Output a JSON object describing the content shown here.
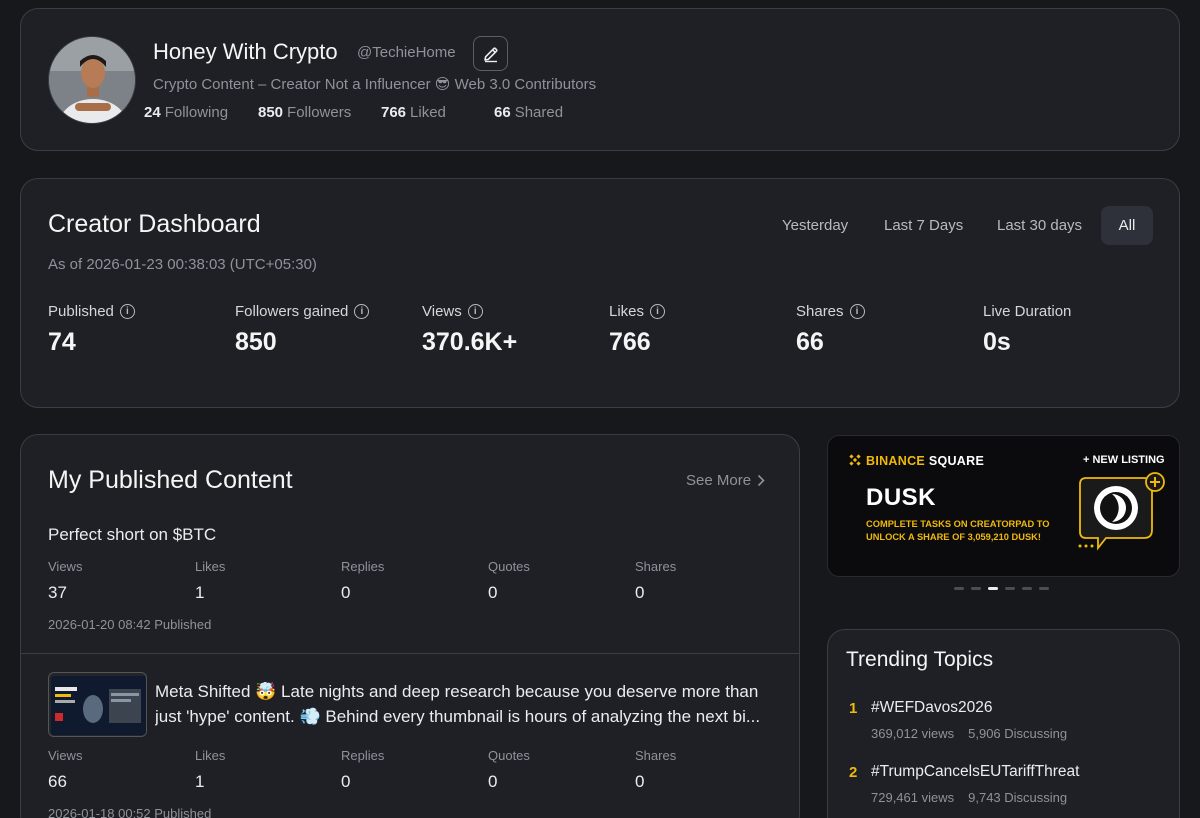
{
  "profile": {
    "display_name": "Honey With Crypto",
    "handle": "@TechieHome",
    "bio": "Crypto Content – Creator Not a Influencer 😎 Web 3.0 Contributors",
    "following_count": "24",
    "following_label": "Following",
    "followers_count": "850",
    "followers_label": "Followers",
    "liked_count": "766",
    "liked_label": "Liked",
    "shared_count": "66",
    "shared_label": "Shared"
  },
  "dashboard": {
    "title": "Creator Dashboard",
    "as_of": "As of 2026-01-23 00:38:03 (UTC+05:30)",
    "ranges": [
      "Yesterday",
      "Last 7 Days",
      "Last 30 days",
      "All"
    ],
    "active_range": "All",
    "metrics": [
      {
        "label": "Published",
        "value": "74",
        "info": true
      },
      {
        "label": "Followers gained",
        "value": "850",
        "info": true
      },
      {
        "label": "Views",
        "value": "370.6K+",
        "info": true
      },
      {
        "label": "Likes",
        "value": "766",
        "info": true
      },
      {
        "label": "Shares",
        "value": "66",
        "info": true
      },
      {
        "label": "Live Duration",
        "value": "0s",
        "info": false
      }
    ]
  },
  "published": {
    "title": "My Published Content",
    "see_more": "See More",
    "columns": [
      "Views",
      "Likes",
      "Replies",
      "Quotes",
      "Shares"
    ],
    "posts": [
      {
        "text": "Perfect short on $BTC",
        "values": [
          "37",
          "1",
          "0",
          "0",
          "0"
        ],
        "date": "2026-01-20 08:42 Published"
      },
      {
        "text_line1": "Meta Shifted 🤯 Late nights and deep research because you deserve more than",
        "text_line2": "just 'hype' content. 💨 Behind every thumbnail is hours of analyzing the next bi...",
        "values": [
          "66",
          "1",
          "0",
          "0",
          "0"
        ],
        "date": "2026-01-18 00:52 Published"
      }
    ]
  },
  "banner": {
    "brand_a": "BINANCE",
    "brand_b": " SQUARE",
    "new_listing": "+ NEW LISTING",
    "coin": "DUSK",
    "desc_line1": "COMPLETE TASKS ON CREATORPAD TO",
    "desc_line2": "UNLOCK A SHARE OF 3,059,210 DUSK!",
    "slide_count": 6,
    "active_slide": 3,
    "colors": {
      "accent": "#f0b90b",
      "background": "#0b0b0d"
    }
  },
  "trending": {
    "title": "Trending Topics",
    "items": [
      {
        "rank": "1",
        "tag": "#WEFDavos2026",
        "views": "369,012 views",
        "discussing": "5,906 Discussing"
      },
      {
        "rank": "2",
        "tag": "#TrumpCancelsEUTariffThreat",
        "views": "729,461 views",
        "discussing": "9,743 Discussing"
      }
    ]
  }
}
